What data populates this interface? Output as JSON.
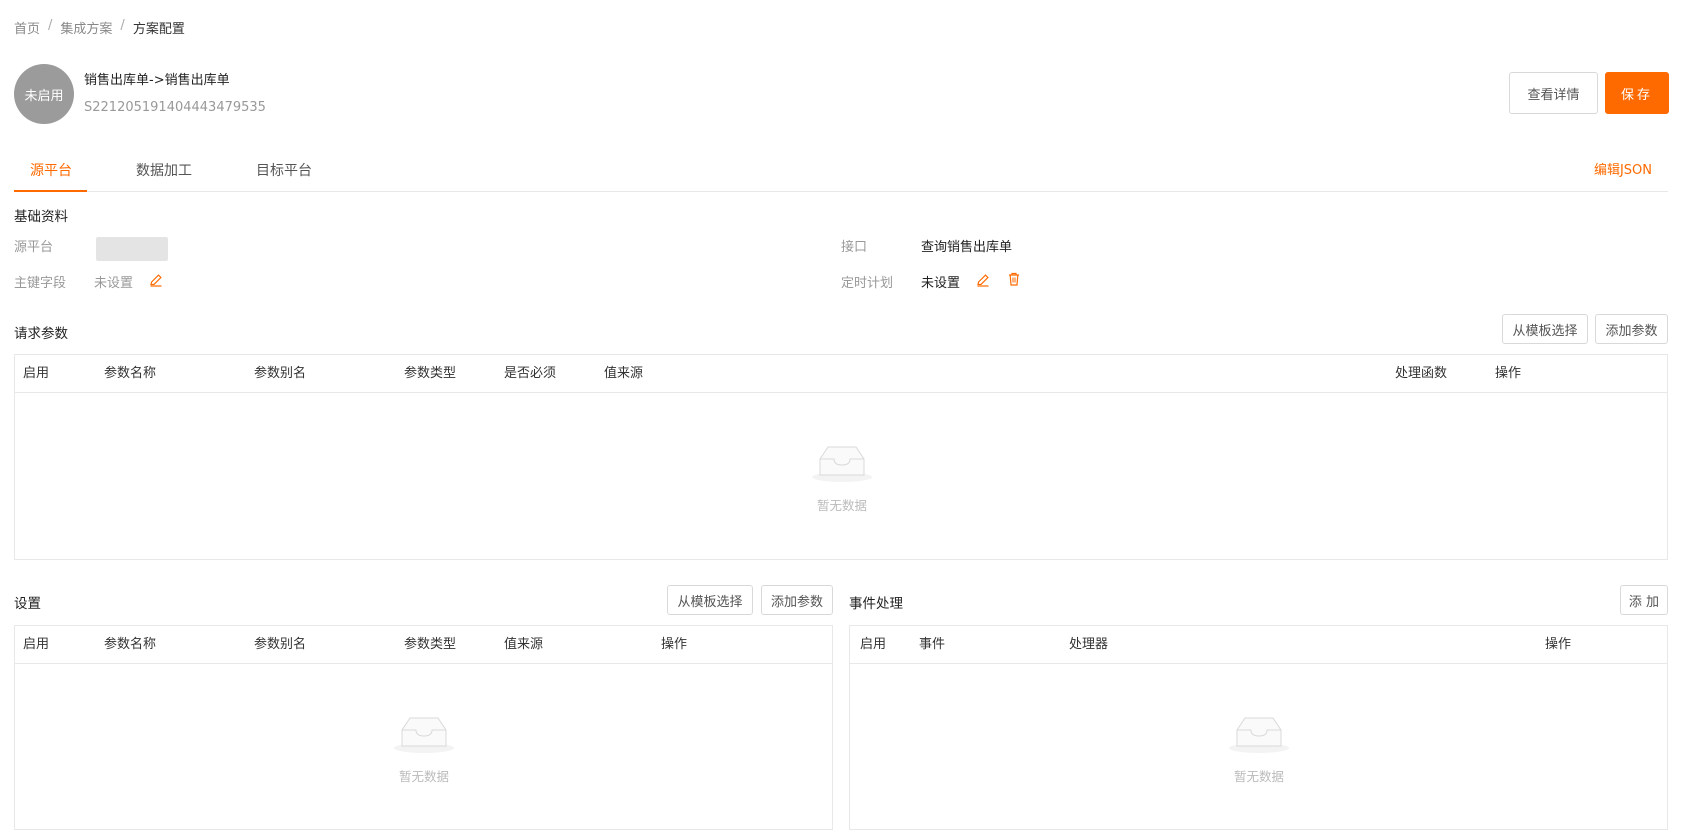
{
  "breadcrumb": {
    "items": [
      "首页",
      "集成方案",
      "方案配置"
    ],
    "separator": "/"
  },
  "header": {
    "status": "未启用",
    "title": "销售出库单->销售出库单",
    "code": "S2212051914044434795 35",
    "view_details_label": "查看详情",
    "save_label": "保存"
  },
  "tabs": {
    "items": [
      "源平台",
      "数据加工",
      "目标平台"
    ],
    "active_index": 0,
    "edit_json_label": "编辑JSON"
  },
  "basic": {
    "title": "基础资料",
    "source_platform_label": "源平台",
    "primary_key_label": "主键字段",
    "primary_key_value": "未设置",
    "interface_label": "接口",
    "interface_value": "查询销售出库单",
    "schedule_label": "定时计划",
    "schedule_value": "未设置"
  },
  "request_params": {
    "title": "请求参数",
    "template_btn": "从模板选择",
    "add_btn": "添加参数",
    "columns": [
      "启用",
      "参数名称",
      "参数别名",
      "参数类型",
      "是否必须",
      "值来源",
      "处理函数",
      "操作"
    ],
    "empty_text": "暂无数据"
  },
  "settings": {
    "title": "设置",
    "template_btn": "从模板选择",
    "add_btn": "添加参数",
    "columns": [
      "启用",
      "参数名称",
      "参数别名",
      "参数类型",
      "值来源",
      "操作"
    ],
    "empty_text": "暂无数据"
  },
  "events": {
    "title": "事件处理",
    "add_btn": "添 加",
    "columns": [
      "启用",
      "事件",
      "处理器",
      "操作"
    ],
    "empty_text": "暂无数据"
  },
  "colors": {
    "accent": "#ff6a00",
    "avatar_bg": "#9b9b9b",
    "border": "#e8e8e8"
  },
  "icons": {
    "edit": "pencil-icon",
    "delete": "trash-icon",
    "empty": "inbox-icon"
  }
}
